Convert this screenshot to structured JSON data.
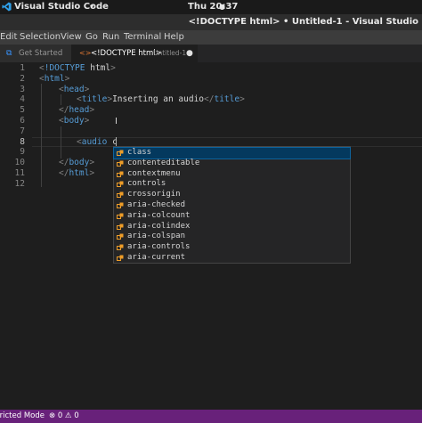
{
  "topbar": {
    "app_name": "Visual Studio Code",
    "app_menu_arrow": "▾",
    "clock": "Thu 20:37",
    "clock_arrow": "●"
  },
  "titlebar": {
    "title": "<!DOCTYPE html> • Untitled-1 - Visual Studio"
  },
  "menubar": {
    "items": [
      "Edit",
      "Selection",
      "View",
      "Go",
      "Run",
      "Terminal",
      "Help"
    ]
  },
  "tabs": {
    "get_started": {
      "label": "Get Started",
      "icon": "vscode-icon"
    },
    "untitled": {
      "label": "<!DOCTYPE html>",
      "sub": "Untitled-1",
      "dirty_dot": "●",
      "icon": "html-icon"
    }
  },
  "editor": {
    "line_numbers": [
      "1",
      "2",
      "3",
      "4",
      "5",
      "6",
      "7",
      "8",
      "9",
      "10",
      "11",
      "12"
    ],
    "active_line": "8",
    "lines": {
      "l1_lt": "<",
      "l1_kw": "!DOCTYPE",
      "l1_attr": " html",
      "l1_gt": ">",
      "l2_lt": "<",
      "l2_tag": "html",
      "l2_gt": ">",
      "l3_lt": "<",
      "l3_tag": "head",
      "l3_gt": ">",
      "l4_lt": "<",
      "l4_tag": "title",
      "l4_gt": ">",
      "l4_text": "Inserting an audio",
      "l4_clt": "</",
      "l4_ctag": "title",
      "l4_cgt": ">",
      "l5_lt": "</",
      "l5_tag": "head",
      "l5_gt": ">",
      "l6_lt": "<",
      "l6_tag": "body",
      "l6_gt": ">",
      "l8_lt": "<",
      "l8_tag": "audio",
      "l8_text": " c",
      "l10_lt": "</",
      "l10_tag": "body",
      "l10_gt": ">",
      "l11_lt": "</",
      "l11_tag": "html",
      "l11_gt": ">"
    },
    "ibeam": "I"
  },
  "suggestions": {
    "icon": "property-icon",
    "items": [
      "class",
      "contenteditable",
      "contextmenu",
      "controls",
      "crossorigin",
      "aria-checked",
      "aria-colcount",
      "aria-colindex",
      "aria-colspan",
      "aria-controls",
      "aria-current"
    ],
    "selected_index": 0
  },
  "statusbar": {
    "restricted_mode": "tricted Mode",
    "problems": "⊗ 0 ⚠ 0",
    "color": "#68217a"
  }
}
